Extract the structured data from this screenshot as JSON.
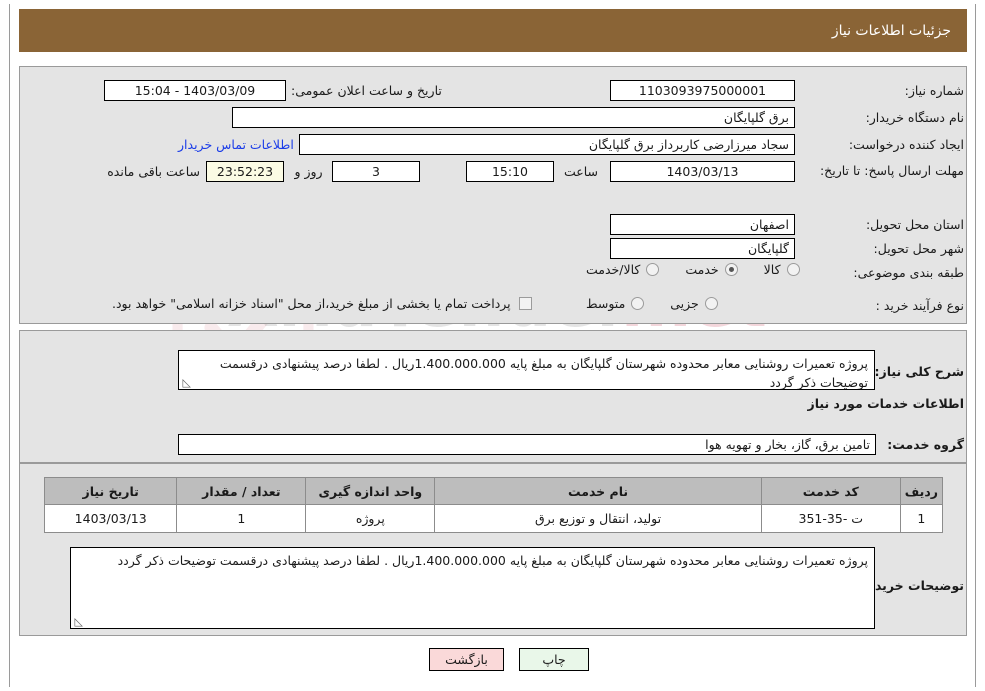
{
  "header": {
    "title": "جزئیات اطلاعات نیاز"
  },
  "top": {
    "labels": {
      "need_number": "شماره نیاز:",
      "buyer_org": "نام دستگاه خریدار:",
      "creator": "ایجاد کننده درخواست:",
      "deadline": "مهلت ارسال پاسخ: تا تاریخ:",
      "province": "استان محل تحویل:",
      "city": "شهر محل تحویل:",
      "category": "طبقه بندی موضوعی:",
      "purchase_type": "نوع فرآیند خرید :",
      "announce_datetime": "تاریخ و ساعت اعلان عمومی:",
      "hour": "ساعت",
      "days_and": "روز و",
      "hours_remaining": "ساعت باقی مانده"
    },
    "values": {
      "need_number": "1103093975000001",
      "buyer_org": "برق گلپایگان",
      "creator": "سجاد میرزارضی کاربرداز برق گلپایگان",
      "deadline_date": "1403/03/13",
      "deadline_hour": "15:10",
      "days_left": "3",
      "countdown": "23:52:23",
      "province": "اصفهان",
      "city": "گلپایگان",
      "announce_datetime": "1403/03/09 - 15:04"
    },
    "contact_link": "اطلاعات تماس خریدار",
    "category_options": [
      {
        "label": "کالا",
        "selected": false
      },
      {
        "label": "خدمت",
        "selected": true
      },
      {
        "label": "کالا/خدمت",
        "selected": false
      }
    ],
    "purchase_options": [
      {
        "label": "جزیی",
        "selected": false
      },
      {
        "label": "متوسط",
        "selected": false
      }
    ],
    "treasury_checkbox": {
      "label": "پرداخت تمام یا بخشی از مبلغ خرید،از محل \"اسناد خزانه اسلامی\" خواهد بود.",
      "checked": false
    }
  },
  "middle": {
    "need_summary_label": "شرح کلی نیاز:",
    "need_summary_value": "پروژه تعمیرات روشنایی معابر محدوده شهرستان گلپایگان به مبلغ پایه 1.400.000.000ریال . لطفا درصد پیشنهادی درقسمت توضیحات ذکر گردد",
    "section_title": "اطلاعات خدمات مورد نیاز",
    "service_group_label": "گروه خدمت:",
    "service_group_value": "تامین برق، گاز، بخار و تهویه هوا"
  },
  "table": {
    "columns": [
      "ردیف",
      "کد خدمت",
      "نام خدمت",
      "واحد اندازه گیری",
      "تعداد / مقدار",
      "تاریخ نیاز"
    ],
    "rows": [
      {
        "radif": "1",
        "code": "ت -35-351",
        "name": "تولید، انتقال و توزیع برق",
        "unit": "پروژه",
        "qty": "1",
        "date": "1403/03/13"
      }
    ]
  },
  "buyer_comments": {
    "label": "توضیحات خریدار:",
    "value": "پروژه تعمیرات روشنایی معابر محدوده شهرستان گلپایگان به مبلغ پایه 1.400.000.000ریال . لطفا درصد پیشنهادی درقسمت توضیحات ذکر گردد"
  },
  "buttons": {
    "print": "چاپ",
    "back": "بازگشت"
  },
  "watermark": {
    "text_a": "AriaTender",
    "text_b": ".net"
  }
}
